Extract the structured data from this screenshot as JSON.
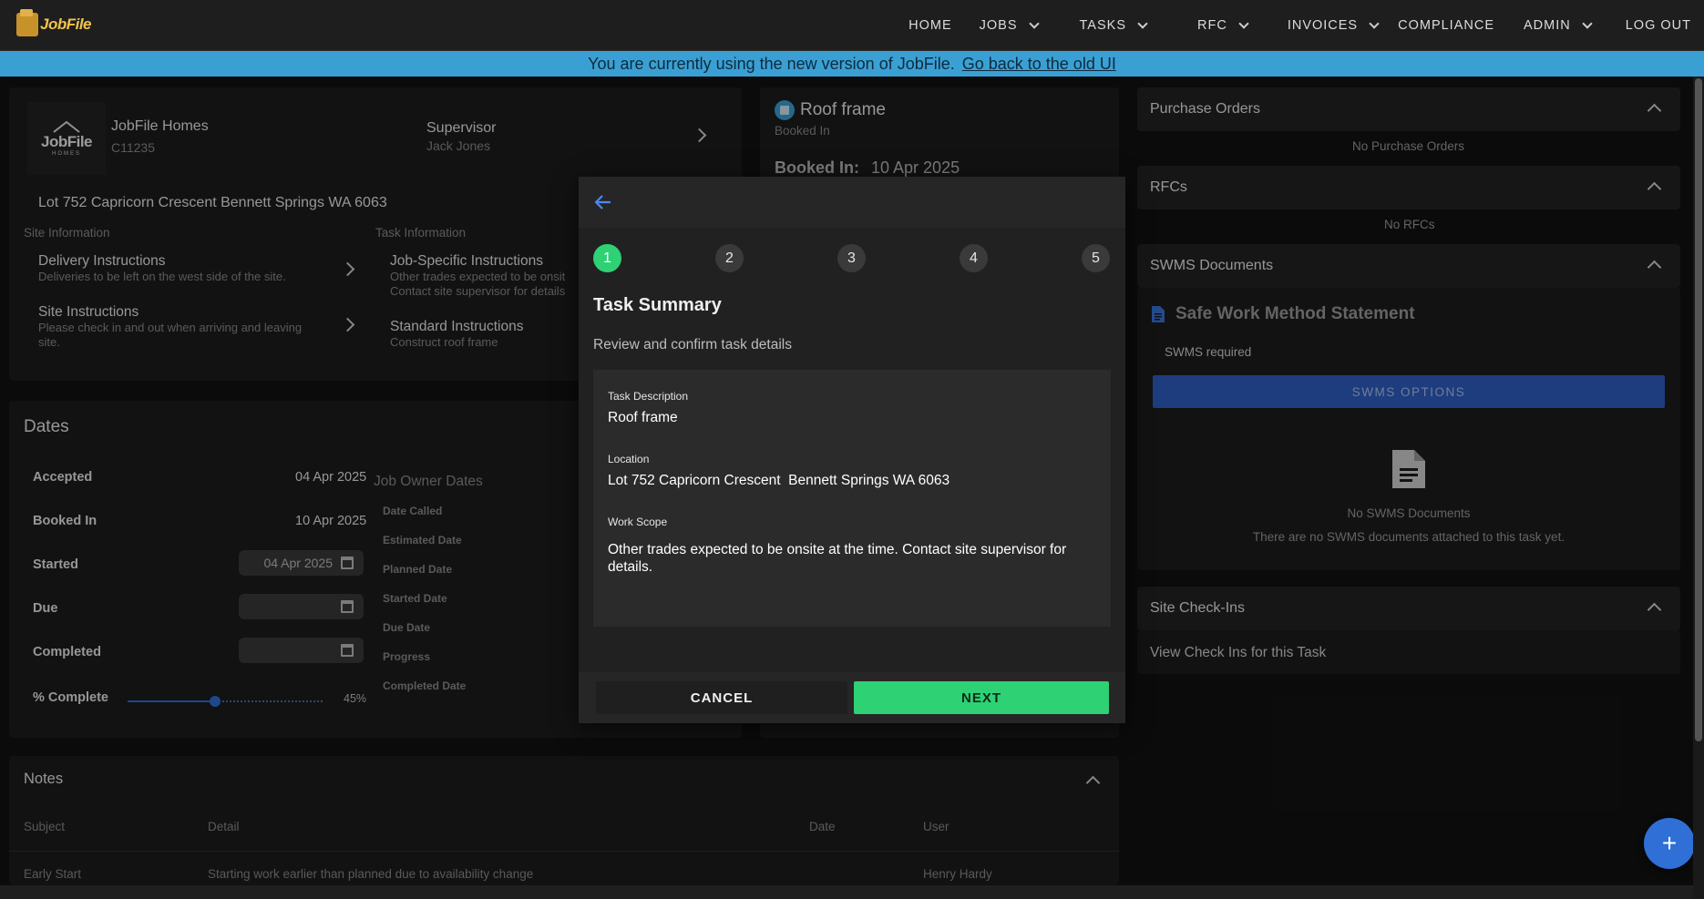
{
  "app": {
    "logo_text": "JobFile"
  },
  "nav": {
    "items": [
      {
        "label": "HOME",
        "dropdown": false
      },
      {
        "label": "JOBS",
        "dropdown": true
      },
      {
        "label": "TASKS",
        "dropdown": true
      },
      {
        "label": "RFC",
        "dropdown": true
      },
      {
        "label": "INVOICES",
        "dropdown": true
      },
      {
        "label": "COMPLIANCE",
        "dropdown": false
      },
      {
        "label": "ADMIN",
        "dropdown": true
      },
      {
        "label": "LOG OUT",
        "dropdown": false
      }
    ]
  },
  "banner": {
    "text": "You are currently using the new version of JobFile.",
    "link": "Go back to the old UI"
  },
  "job": {
    "builder_logo_top": "JobFile",
    "builder_logo_bottom": "HOMES",
    "builder": "JobFile Homes",
    "code": "C11235",
    "supervisor_label": "Supervisor",
    "supervisor": "Jack Jones",
    "address": "Lot 752 Capricorn Crescent Bennett Springs WA 6063"
  },
  "site_info": {
    "heading": "Site Information",
    "items": [
      {
        "title": "Delivery Instructions",
        "detail": "Deliveries to be left on the west side of the site."
      },
      {
        "title": "Site Instructions",
        "detail": "Please check in and out when arriving and leaving",
        "detail2": "site."
      }
    ]
  },
  "task_info": {
    "heading": "Task Information",
    "items": [
      {
        "title": "Job-Specific Instructions",
        "detail": "Other trades expected to be onsit",
        "detail2": "Contact site supervisor for details"
      },
      {
        "title": "Standard Instructions",
        "detail": "Construct roof frame"
      }
    ]
  },
  "task": {
    "title": "Roof frame",
    "status": "Booked In",
    "booked_label": "Booked In:",
    "booked_date": "10 Apr 2025"
  },
  "dates": {
    "heading": "Dates",
    "accepted_label": "Accepted",
    "accepted": "04 Apr 2025",
    "booked_label": "Booked In",
    "booked": "10 Apr 2025",
    "started_label": "Started",
    "started": "04 Apr 2025",
    "due_label": "Due",
    "completed_label": "Completed",
    "percent_label": "% Complete",
    "percent_text": "45%",
    "percent_value": 0.45
  },
  "owner_dates": {
    "heading": "Job Owner Dates",
    "labels": [
      "Date Called",
      "Estimated Date",
      "Planned Date",
      "Started Date",
      "Due Date",
      "Progress",
      "Completed Date"
    ]
  },
  "notes": {
    "heading": "Notes",
    "columns": [
      "Subject",
      "Detail",
      "Date",
      "User"
    ],
    "rows": [
      {
        "subject": "Early Start",
        "detail": "Starting work earlier than planned due to availability change",
        "date": "",
        "user": "Henry Hardy"
      }
    ]
  },
  "right": {
    "po_heading": "Purchase Orders",
    "po_empty": "No Purchase Orders",
    "rfc_heading": "RFCs",
    "rfc_empty": "No RFCs",
    "swms_heading": "SWMS Documents",
    "swms_title": "Safe Work Method Statement",
    "swms_required": "SWMS required",
    "swms_button": "SWMS OPTIONS",
    "swms_empty_title": "No SWMS Documents",
    "swms_empty_detail": "There are no SWMS documents attached to this task yet.",
    "checkins_heading": "Site Check-Ins",
    "checkins_link": "View Check Ins for this Task"
  },
  "modal": {
    "steps": [
      "1",
      "2",
      "3",
      "4",
      "5"
    ],
    "active_step": 1,
    "title": "Task Summary",
    "subtitle": "Review and confirm task details",
    "desc_label": "Task Description",
    "desc": "Roof frame",
    "loc_label": "Location",
    "loc": "Lot 752 Capricorn Crescent  Bennett Springs WA 6063",
    "scope_label": "Work Scope",
    "scope": "Other trades expected to be onsite at the time. Contact site supervisor for details.",
    "cancel": "CANCEL",
    "next": "NEXT"
  },
  "colors": {
    "accent_green": "#2fd175",
    "accent_blue": "#2f6fd6",
    "banner": "#3aa0d4"
  },
  "fab_icon": "plus-icon"
}
